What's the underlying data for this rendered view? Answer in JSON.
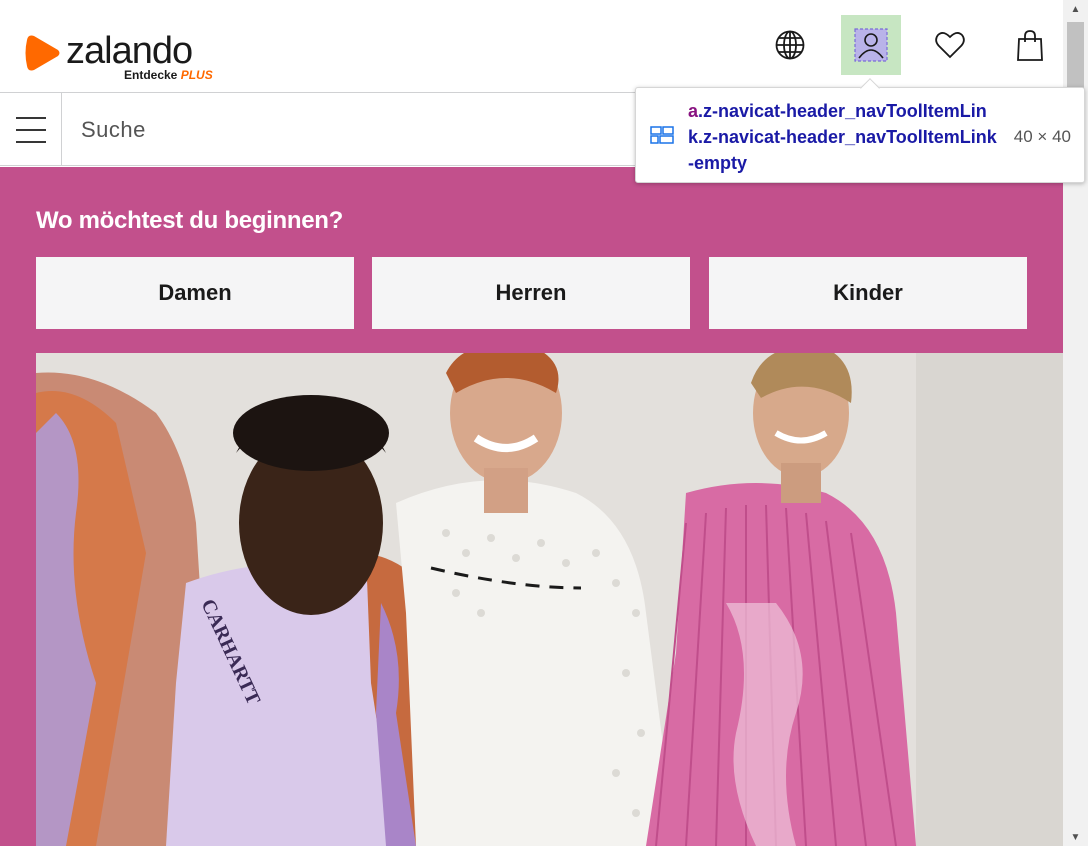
{
  "header": {
    "logo_text": "zalando",
    "logo_sub_text": "Entdecke",
    "logo_plus_text": "PLUS",
    "brand_color": "#ff6900",
    "tools": [
      {
        "name": "language-icon"
      },
      {
        "name": "user-account-icon",
        "highlighted": true
      },
      {
        "name": "wishlist-heart-icon"
      },
      {
        "name": "shopping-bag-icon"
      }
    ]
  },
  "search": {
    "placeholder": "Suche"
  },
  "main": {
    "background_color": "#c2508c",
    "headline": "Wo möchtest du beginnen?",
    "categories": [
      {
        "label": "Damen"
      },
      {
        "label": "Herren"
      },
      {
        "label": "Kinder"
      }
    ],
    "hero": {
      "shirt_print": "CARHARTT"
    }
  },
  "devtools_tooltip": {
    "tag": "a",
    "selector": ".z-navicat-header_navToolItemLink.z-navicat-header_navToolItemLink-empty",
    "size": "40 × 40",
    "highlight_color": "#c7e6c2"
  }
}
